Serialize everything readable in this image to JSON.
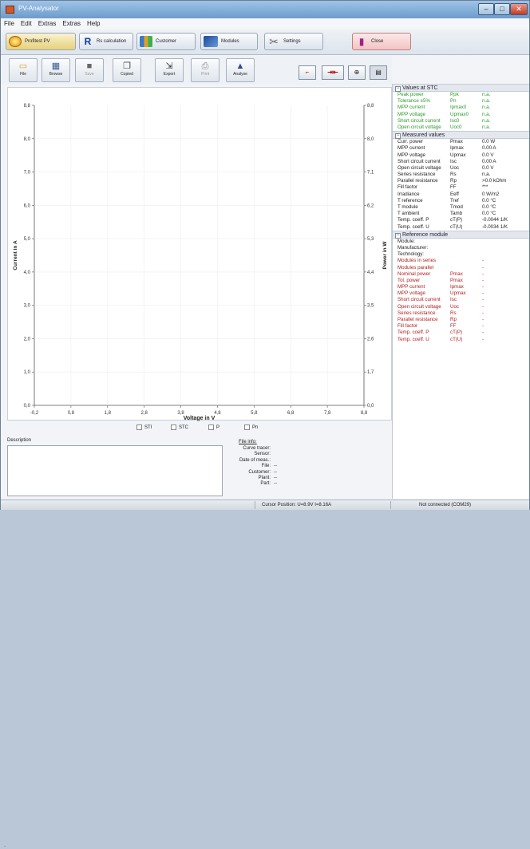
{
  "window": {
    "title": "PV-Analysator"
  },
  "menu": [
    "File",
    "Edit",
    "Extras",
    "Extras",
    "Help"
  ],
  "modules": {
    "profitest": "Profitest PV",
    "rs": "Rs calculation",
    "customer": "Customer",
    "modules": "Modules",
    "settings": "Settings",
    "close": "Close"
  },
  "toolbar": {
    "file": "File",
    "browse": "Browse",
    "save": "Save",
    "copy": "Copied",
    "export": "Export",
    "print": "Print",
    "analyse": "Analyse"
  },
  "chart_data": {
    "type": "line",
    "xlabel": "Voltage in V",
    "ylabel": "Current in A",
    "y2label": "Power in W",
    "x_ticks": [
      "-0,2",
      "0,8",
      "1,8",
      "2,8",
      "3,8",
      "4,8",
      "5,8",
      "6,8",
      "7,8",
      "8,8"
    ],
    "y_ticks": [
      "0,0",
      "1,0",
      "2,0",
      "3,0",
      "4,0",
      "5,0",
      "6,0",
      "7,0",
      "8,0",
      "8,8"
    ],
    "y2_ticks": [
      "0,0",
      "1,7",
      "2,6",
      "3,5",
      "4,4",
      "5,3",
      "6,2",
      "7,1",
      "8,0",
      "8,8"
    ],
    "series": []
  },
  "checkboxes": [
    "STI",
    "STC",
    "P",
    "Pn"
  ],
  "stc": {
    "title": "Values at STC",
    "rows": [
      [
        "Peak power",
        "Ppk",
        "n.a."
      ],
      [
        "Tolerance ±5%",
        "Pn",
        "n.a."
      ],
      [
        "MPP current",
        "Ipmax0",
        "n.a."
      ],
      [
        "MPP voltage",
        "Upmax0",
        "n.a."
      ],
      [
        "Short circuit current",
        "Isc0",
        "n.a."
      ],
      [
        "Open circuit voltage",
        "Uoc0",
        "n.a."
      ]
    ]
  },
  "measured": {
    "title": "Measured values",
    "rows": [
      [
        "Curr. power",
        "Pmax",
        "0.0 W"
      ],
      [
        "MPP current",
        "Ipmax",
        "0.00 A"
      ],
      [
        "MPP voltage",
        "Upmax",
        "0.0 V"
      ],
      [
        "Short circuit current",
        "Isc",
        "0.00 A"
      ],
      [
        "Open circuit voltage",
        "Uoc",
        "0.0 V"
      ],
      [
        "Series resistance",
        "Rs",
        "n.a."
      ],
      [
        "Parallel resistance",
        "Rp",
        ">0.0 kOhm"
      ],
      [
        "Fill factor",
        "FF",
        "***"
      ],
      [
        "Irradiance",
        "Eeff",
        "0 W/m2"
      ],
      [
        "T reference",
        "Tref",
        "0.0 °C"
      ],
      [
        "T module",
        "Tmod",
        "0.0 °C"
      ],
      [
        "T ambient",
        "Tamb",
        "0.0 °C"
      ],
      [
        "Temp. coeff. P",
        "cT(P)",
        "-0.0044 1/K"
      ],
      [
        "Temp. coeff. U",
        "cT(U)",
        "-0.0034 1/K"
      ]
    ]
  },
  "reference": {
    "title": "Reference module",
    "rows": [
      [
        "Module:",
        "",
        ""
      ],
      [
        "Manufacturer:",
        "",
        ""
      ],
      [
        "Technology:",
        "",
        ""
      ],
      [
        "Modules in series",
        "",
        "-"
      ],
      [
        "Modules parallel",
        "",
        "-"
      ],
      [
        "Nominal power",
        "Pmax",
        "-"
      ],
      [
        "Tol. power",
        "Pmax",
        "-"
      ],
      [
        "MPP current",
        "Ipmax",
        "-"
      ],
      [
        "MPP voltage",
        "Upmax",
        "-"
      ],
      [
        "Short circuit current",
        "Isc",
        "-"
      ],
      [
        "Open circuit voltage",
        "Uoc",
        "-"
      ],
      [
        "Series resistance",
        "Rs",
        "-"
      ],
      [
        "Parallel resistance",
        "Rp",
        "-"
      ],
      [
        "Fill factor",
        "FF",
        "-"
      ],
      [
        "Temp. coeff. P",
        "cT(P)",
        "-"
      ],
      [
        "Temp. coeff. U",
        "cT(U)",
        "-"
      ]
    ]
  },
  "description": {
    "label": "Description"
  },
  "fileinfo": {
    "header": "File info:",
    "labels": [
      "Curve tracer:",
      "Sensor:",
      "Date of meas.:",
      "File:",
      "Customer:",
      "Plant:",
      "Part:"
    ],
    "values": [
      "",
      "",
      "",
      "--",
      "--",
      "--",
      "--"
    ]
  },
  "status": {
    "position": "Cursor Position: U=8.9V I=8.16A",
    "connection": "Not connected (COM29)"
  }
}
